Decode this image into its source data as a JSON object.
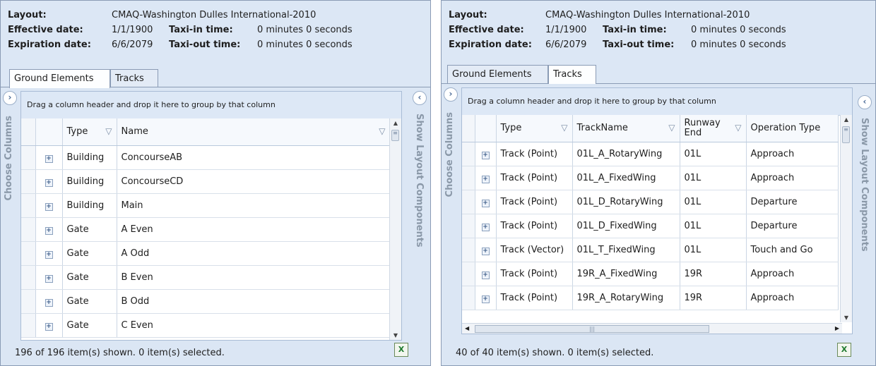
{
  "left": {
    "header": {
      "layout_label": "Layout:",
      "layout_value": "CMAQ-Washington Dulles International-2010",
      "effective_label": "Effective date:",
      "effective_value": "1/1/1900",
      "taxi_in_label": "Taxi-in time:",
      "taxi_in_value": "0 minutes 0 seconds",
      "expiration_label": "Expiration date:",
      "expiration_value": "6/6/2079",
      "taxi_out_label": "Taxi-out time:",
      "taxi_out_value": "0 minutes 0 seconds"
    },
    "tabs": [
      "Ground Elements",
      "Tracks"
    ],
    "active_tab": "Ground Elements",
    "choose_columns": "Choose Columns",
    "show_layout": "Show Layout Components",
    "group_hint": "Drag a column header and drop it here to group by that column",
    "columns": [
      "Type",
      "Name"
    ],
    "rows": [
      [
        "Building",
        "ConcourseAB"
      ],
      [
        "Building",
        "ConcourseCD"
      ],
      [
        "Building",
        "Main"
      ],
      [
        "Gate",
        "A Even"
      ],
      [
        "Gate",
        "A Odd"
      ],
      [
        "Gate",
        "B Even"
      ],
      [
        "Gate",
        "B Odd"
      ],
      [
        "Gate",
        "C Even"
      ]
    ],
    "status": "196 of 196 item(s) shown. 0 item(s) selected."
  },
  "right": {
    "header": {
      "layout_label": "Layout:",
      "layout_value": "CMAQ-Washington Dulles International-2010",
      "effective_label": "Effective date:",
      "effective_value": "1/1/1900",
      "taxi_in_label": "Taxi-in time:",
      "taxi_in_value": "0 minutes 0 seconds",
      "expiration_label": "Expiration date:",
      "expiration_value": "6/6/2079",
      "taxi_out_label": "Taxi-out time:",
      "taxi_out_value": "0 minutes 0 seconds"
    },
    "tabs": [
      "Ground Elements",
      "Tracks"
    ],
    "active_tab": "Tracks",
    "choose_columns": "Choose Columns",
    "show_layout": "Show Layout Components",
    "group_hint": "Drag a column header and drop it here to group by that column",
    "columns": [
      "Type",
      "TrackName",
      "Runway End",
      "Operation Type"
    ],
    "rows": [
      [
        "Track (Point)",
        "01L_A_RotaryWing",
        "01L",
        "Approach"
      ],
      [
        "Track (Point)",
        "01L_A_FixedWing",
        "01L",
        "Approach"
      ],
      [
        "Track (Point)",
        "01L_D_RotaryWing",
        "01L",
        "Departure"
      ],
      [
        "Track (Point)",
        "01L_D_FixedWing",
        "01L",
        "Departure"
      ],
      [
        "Track (Vector)",
        "01L_T_FixedWing",
        "01L",
        "Touch and Go"
      ],
      [
        "Track (Point)",
        "19R_A_FixedWing",
        "19R",
        "Approach"
      ],
      [
        "Track (Point)",
        "19R_A_RotaryWing",
        "19R",
        "Approach"
      ]
    ],
    "status": "40 of 40 item(s) shown. 0 item(s) selected."
  },
  "icons": {
    "expand_sidebar": "chevron-right-icon",
    "collapse_sidebar": "chevron-left-icon",
    "filter": "filter-funnel-icon",
    "excel_export": "excel-export-icon",
    "row_expander": "plus-expander-icon"
  }
}
